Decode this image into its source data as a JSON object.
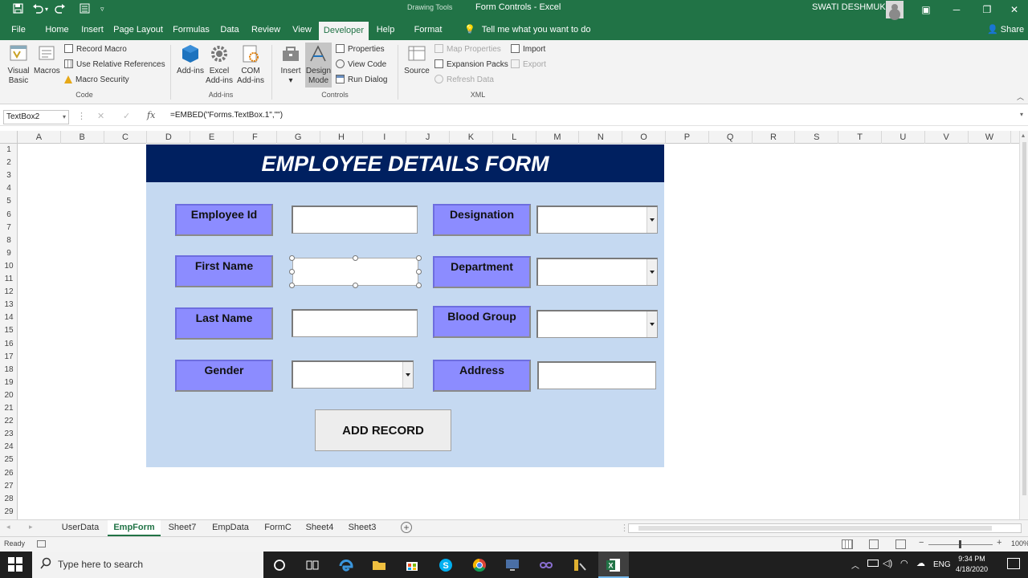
{
  "window": {
    "title": "Form Controls  -  Excel",
    "contextual_tools": "Drawing Tools",
    "user_name": "SWATI DESHMUKH"
  },
  "ribbon_tabs": [
    "File",
    "Home",
    "Insert",
    "Page Layout",
    "Formulas",
    "Data",
    "Review",
    "View",
    "Developer",
    "Help",
    "Format"
  ],
  "active_tab": "Developer",
  "tell_me": "Tell me what you want to do",
  "share": "Share",
  "ribbon": {
    "code": {
      "visual_basic": "Visual Basic",
      "macros": "Macros",
      "record_macro": "Record Macro",
      "relative_refs": "Use Relative References",
      "macro_security": "Macro Security",
      "label": "Code"
    },
    "addins": {
      "addins": "Add-ins",
      "excel_addins": "Excel Add-ins",
      "com_addins": "COM Add-ins",
      "label": "Add-ins"
    },
    "controls": {
      "insert": "Insert",
      "design_mode": "Design Mode",
      "properties": "Properties",
      "view_code": "View Code",
      "run_dialog": "Run Dialog",
      "label": "Controls"
    },
    "xml": {
      "source": "Source",
      "map_properties": "Map Properties",
      "expansion_packs": "Expansion Packs",
      "refresh_data": "Refresh Data",
      "import": "Import",
      "export": "Export",
      "label": "XML"
    }
  },
  "formula_bar": {
    "name_box": "TextBox2",
    "formula": "=EMBED(\"Forms.TextBox.1\",\"\")"
  },
  "columns": [
    "A",
    "B",
    "C",
    "D",
    "E",
    "F",
    "G",
    "H",
    "I",
    "J",
    "K",
    "L",
    "M",
    "N",
    "O",
    "P",
    "Q",
    "R",
    "S",
    "T",
    "U",
    "V",
    "W"
  ],
  "rows": [
    "1",
    "2",
    "3",
    "4",
    "5",
    "6",
    "7",
    "8",
    "9",
    "10",
    "11",
    "12",
    "13",
    "14",
    "15",
    "16",
    "17",
    "18",
    "19",
    "20",
    "21",
    "22",
    "23",
    "24",
    "25",
    "26",
    "27",
    "28",
    "29"
  ],
  "form": {
    "title": "EMPLOYEE DETAILS FORM",
    "labels": {
      "employee_id": "Employee Id",
      "first_name": "First Name",
      "last_name": "Last Name",
      "gender": "Gender",
      "designation": "Designation",
      "department": "Department",
      "blood_group": "Blood Group",
      "address": "Address"
    },
    "add_button": "ADD RECORD"
  },
  "sheets": [
    "UserData",
    "EmpForm",
    "Sheet7",
    "EmpData",
    "FormC",
    "Sheet4",
    "Sheet3"
  ],
  "active_sheet": "EmpForm",
  "status": {
    "ready": "Ready",
    "zoom": "100%"
  },
  "taskbar": {
    "search_placeholder": "Type here to search",
    "language": "ENG",
    "time": "9:34 PM",
    "date": "4/18/2020"
  },
  "colors": {
    "excel_green": "#217346",
    "form_bg": "#c5d9f1",
    "title_bg": "#002060",
    "label_bg": "#8c8cff"
  }
}
